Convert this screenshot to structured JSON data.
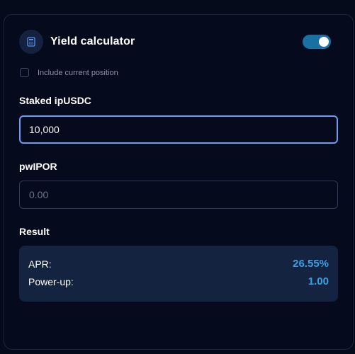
{
  "header": {
    "title": "Yield calculator",
    "icon": "calculator-icon",
    "toggle_on": true
  },
  "options": {
    "include_current_position_label": "Include current position",
    "include_current_position_checked": false
  },
  "staked": {
    "label": "Staked ipUSDC",
    "value": "10,000"
  },
  "pwipor": {
    "label": "pwIPOR",
    "placeholder": "0.00"
  },
  "result": {
    "label": "Result",
    "apr_label": "APR:",
    "apr_value": "26.55%",
    "powerup_label": "Power-up:",
    "powerup_value": "1.00"
  },
  "colors": {
    "background": "#060b1c",
    "accent": "#3aa0e6",
    "toggle": "#1a6fa3",
    "focus_border": "#6e9cf5"
  }
}
